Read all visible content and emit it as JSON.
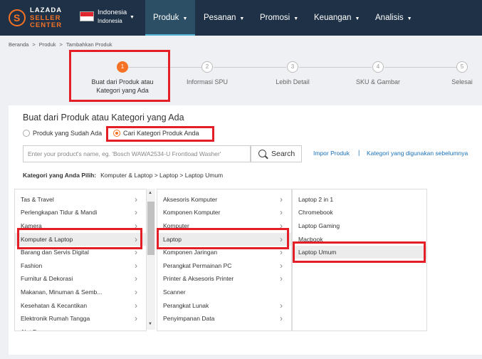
{
  "brand": {
    "line1": "LAZADA",
    "line2": "SELLER",
    "line3": "CENTER",
    "symbol": "S"
  },
  "country": {
    "label": "Indonesia",
    "sub": "Indonesia"
  },
  "nav": [
    {
      "label": "Produk",
      "active": true
    },
    {
      "label": "Pesanan"
    },
    {
      "label": "Promosi"
    },
    {
      "label": "Keuangan"
    },
    {
      "label": "Analisis"
    }
  ],
  "breadcrumb": [
    "Beranda",
    "Produk",
    "Tambahkan Produk"
  ],
  "steps": [
    {
      "num": "1",
      "label1": "Buat dari Produk atau",
      "label2": "Kategori yang Ada"
    },
    {
      "num": "2",
      "label1": "Informasi SPU",
      "label2": ""
    },
    {
      "num": "3",
      "label1": "Lebih Detail",
      "label2": ""
    },
    {
      "num": "4",
      "label1": "SKU & Gambar",
      "label2": ""
    },
    {
      "num": "5",
      "label1": "Selesai",
      "label2": ""
    }
  ],
  "card": {
    "title": "Buat dari Produk atau Kategori yang Ada",
    "radio_existing": "Produk yang Sudah Ada",
    "radio_category": "Cari Kategori Produk Anda",
    "search_placeholder": "Enter your product's name, eg. 'Bosch WAWA2534-U Frontload Washer'",
    "search_button": "Search",
    "import_link": "Impor Produk",
    "link_sep": "|",
    "used_link": "Kategori yang digunakan sebelumnya",
    "chosen_label": "Kategori yang Anda Pilih:",
    "chosen_path": "Komputer & Laptop > Laptop > Laptop Umum"
  },
  "col1": [
    "Tas & Travel",
    "Perlengkapan Tidur & Mandi",
    "Kamera",
    "Komputer & Laptop",
    "Barang dan Servis Digital",
    "Fashion",
    "Furnitur & Dekorasi",
    "Makanan, Minuman & Semb...",
    "Kesehatan & Kecantikan",
    "Elektronik Rumah Tangga",
    "Alat Dapur"
  ],
  "col2": [
    "Aksesoris Komputer",
    "Komponen Komputer",
    "Komputer",
    "Laptop",
    "Komponen Jaringan",
    "Perangkat Permainan PC",
    "Printer & Aksesoris Printer",
    "Scanner",
    "Perangkat Lunak",
    "Penyimpanan Data"
  ],
  "col3": [
    "Laptop 2 in 1",
    "Chromebook",
    "Laptop Gaming",
    "Macbook",
    "Laptop Umum"
  ],
  "icons": {
    "chevron": "›",
    "caret": "▼",
    "scroll_up": "▲",
    "scroll_down": "▼"
  },
  "colors": {
    "nav_bg": "#1e3146",
    "accent": "#f57224",
    "highlight": "#e41e26",
    "link": "#1a71b8"
  }
}
